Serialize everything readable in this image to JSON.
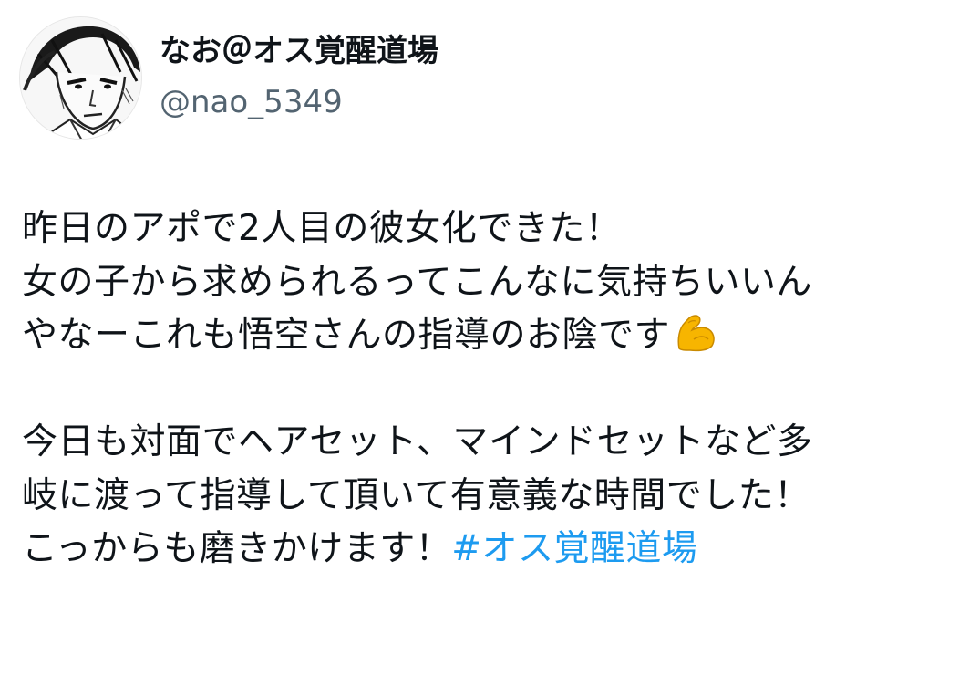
{
  "user": {
    "display_name": "なお＠オス覚醒道場",
    "handle": "@nao_5349",
    "avatar": "manga-style-portrait-avatar"
  },
  "tweet": {
    "line1": "昨日のアポで2人目の彼女化できた！",
    "line2": "女の子から求められるってこんなに気持ちいいん",
    "line3": "やなーこれも悟空さんの指導のお陰です",
    "line3_emoji": "flexed-biceps-icon",
    "line4": "今日も対面でヘアセット、マインドセットなど多",
    "line5": "岐に渡って指導して頂いて有意義な時間でした！",
    "line6": "こっからも磨きかけます！",
    "hashtag": "#オス覚醒道場"
  },
  "colors": {
    "text": "#0f1419",
    "handle": "#536471",
    "hashtag": "#1d9bf0",
    "background": "#ffffff"
  }
}
